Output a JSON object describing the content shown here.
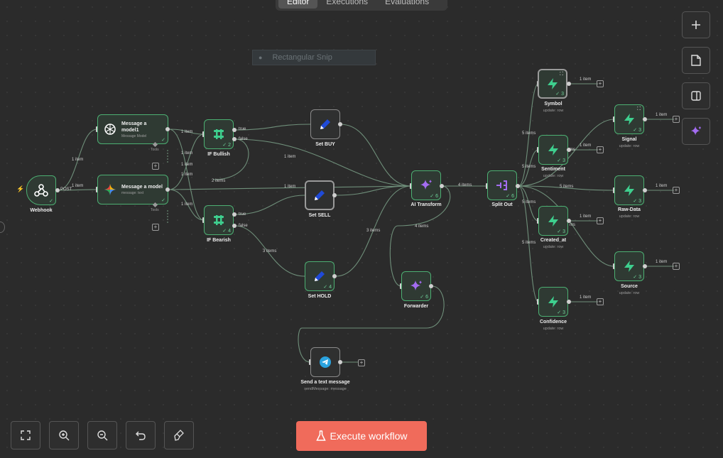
{
  "tabs": [
    {
      "label": "Editor",
      "active": true
    },
    {
      "label": "Executions",
      "active": false
    },
    {
      "label": "Evaluations",
      "active": false
    }
  ],
  "snip_label": "Rectangular Snip",
  "nodes": {
    "webhook": {
      "label": "Webhook",
      "port_label": "POST"
    },
    "msg1": {
      "title": "Message a model1",
      "sub": "Message Model",
      "tools": "Tools"
    },
    "msg2": {
      "title": "Message a model",
      "sub": "message: text",
      "tools": "Tools"
    },
    "if_bullish": {
      "label": "IF Bullish",
      "true": "true",
      "false": "false",
      "count": "2"
    },
    "if_bearish": {
      "label": "IF Bearish",
      "true": "true",
      "false": "false",
      "count": "4"
    },
    "set_buy": {
      "label": "Set BUY"
    },
    "set_sell": {
      "label": "Set SELL"
    },
    "set_hold": {
      "label": "Set HOLD",
      "count": "4"
    },
    "ai_transform": {
      "label": "AI Transform",
      "count": "6"
    },
    "forwarder": {
      "label": "Forwarder",
      "count": "6"
    },
    "split_out": {
      "label": "Split Out",
      "count": "6"
    },
    "telegram": {
      "label": "Send a text message",
      "sub": "sendMessage: message"
    },
    "symbol": {
      "label": "Symbol",
      "sub": "update: row",
      "count": "3"
    },
    "sentiment": {
      "label": "Sentiment",
      "sub": "update: row",
      "count": "3"
    },
    "created_at": {
      "label": "Created_at",
      "sub": "update: row",
      "count": "3"
    },
    "confidence": {
      "label": "Confidence",
      "sub": "update: row",
      "count": "3"
    },
    "signal": {
      "label": "Signal",
      "sub": "update: row",
      "count": "3"
    },
    "raw_data": {
      "label": "Raw-Data",
      "sub": "update: row",
      "count": "3"
    },
    "source": {
      "label": "Source",
      "sub": "update: row",
      "count": "3"
    }
  },
  "edge_labels": {
    "one_item": "1 item",
    "two_items": "2 items",
    "three_items": "3 items",
    "four_items": "4 items",
    "five_items": "5 items",
    "ms": "ms"
  },
  "execute_label": "Execute workflow",
  "icons": {
    "add": "plus-icon",
    "sticky": "sticky-note-icon",
    "panel": "panel-icon",
    "ai": "sparkle-icon",
    "fit": "fit-view-icon",
    "zoom_in": "zoom-in-icon",
    "zoom_out": "zoom-out-icon",
    "undo": "undo-icon",
    "clean": "tidy-up-icon"
  },
  "colors": {
    "canvas": "#2b2b2b",
    "node_border": "#4caf72",
    "execute": "#f06b5b",
    "supabase_green": "#3ecf8e",
    "ai_purple": "#a36cf0"
  }
}
